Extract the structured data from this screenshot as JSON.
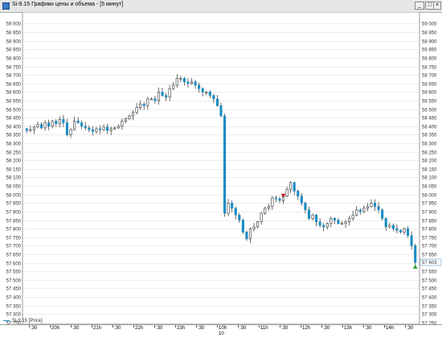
{
  "window": {
    "title": "Si-9.15 Графики цены и объема - [5 минут]",
    "buttons": {
      "minimize": "_",
      "maximize": "□",
      "close": "×"
    }
  },
  "legend": {
    "label": "Si-9.15 [Price]"
  },
  "time_axis": {
    "labels": [
      ":30",
      "20h",
      ":30",
      "21h",
      ":30",
      "22h",
      ":30",
      "23h",
      ":30",
      "10h",
      ":30",
      "11h",
      ":30",
      "12h",
      ":30",
      "13h",
      ":30",
      "14h",
      ":30"
    ],
    "day_label": "10"
  },
  "colors": {
    "body": "#1a8cc4",
    "wick": "#333333",
    "grid": "#d9d9d9",
    "marker_up": "#2ca02c",
    "marker_down": "#c62828"
  },
  "chart_data": {
    "type": "candlestick",
    "title": "Si-9.15 Графики цены и объема - [5 минут]",
    "series": [
      {
        "name": "Si-9.15 [Price]"
      }
    ],
    "ylim": [
      57240,
      59040
    ],
    "yticks": [
      57250,
      57300,
      57350,
      57400,
      57450,
      57500,
      57550,
      57600,
      57650,
      57700,
      57750,
      57800,
      57850,
      57900,
      57950,
      58000,
      58050,
      58100,
      58150,
      58200,
      58250,
      58300,
      58350,
      58400,
      58450,
      58500,
      58550,
      58600,
      58650,
      58700,
      58750,
      58800,
      58850,
      58900,
      58950,
      59000
    ],
    "last_price": "57 603",
    "last_price_value": 57603,
    "close": [
      58375,
      58380,
      58395,
      58410,
      58390,
      58420,
      58400,
      58430,
      58415,
      58440,
      58420,
      58350,
      58380,
      58430,
      58420,
      58400,
      58390,
      58380,
      58370,
      58385,
      58380,
      58395,
      58375,
      58385,
      58390,
      58400,
      58430,
      58445,
      58460,
      58480,
      58510,
      58530,
      58520,
      58560,
      58560,
      58550,
      58600,
      58580,
      58570,
      58620,
      58640,
      58680,
      58680,
      58660,
      58650,
      58660,
      58640,
      58620,
      58600,
      58600,
      58580,
      58560,
      58520,
      58460,
      57890,
      57950,
      57920,
      57880,
      57850,
      57780,
      57740,
      57800,
      57810,
      57840,
      57890,
      57920,
      57930,
      57980,
      57975,
      57965,
      57990,
      58030,
      58070,
      58020,
      57990,
      57950,
      57910,
      57860,
      57880,
      57840,
      57820,
      57810,
      57830,
      57860,
      57850,
      57830,
      57830,
      57840,
      57860,
      57880,
      57910,
      57900,
      57920,
      57930,
      57950,
      57930,
      57910,
      57860,
      57810,
      57820,
      57800,
      57790,
      57780,
      57800,
      57760,
      57700,
      57603
    ],
    "annotations": [
      {
        "text": "buy marker",
        "value": 57575
      },
      {
        "text": "sell marker",
        "value": 57995
      }
    ]
  }
}
